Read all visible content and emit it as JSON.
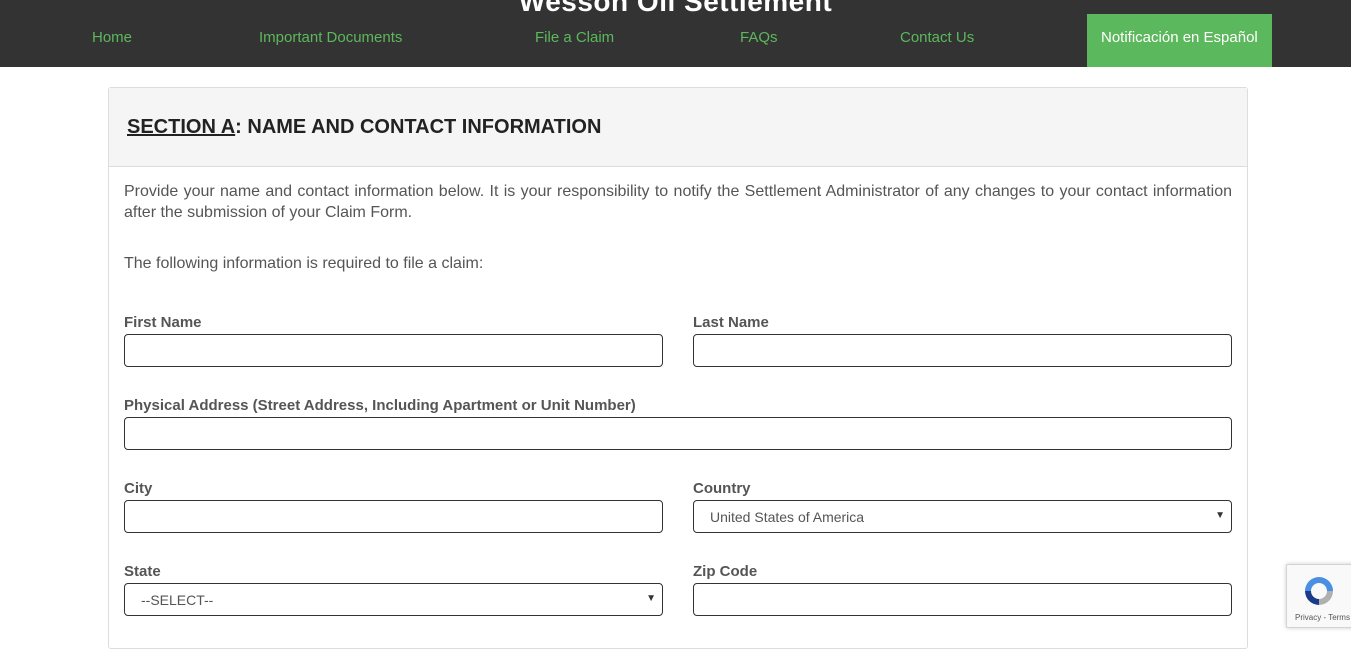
{
  "site": {
    "title": "Wesson Oil Settlement"
  },
  "nav": [
    {
      "label": "Home",
      "active": false
    },
    {
      "label": "Important Documents",
      "active": false
    },
    {
      "label": "File a Claim",
      "active": false
    },
    {
      "label": "FAQs",
      "active": false
    },
    {
      "label": "Contact Us",
      "active": false
    },
    {
      "label": "Notificación en Español",
      "active": true
    }
  ],
  "section": {
    "title_prefix": "SECTION A",
    "title_rest": ": NAME AND CONTACT INFORMATION",
    "intro": "Provide your name and contact information below. It is your responsibility to notify the Settlement Administrator of any changes to your contact information after the submission of your Claim Form.",
    "required_note": "The following information is required to file a claim:"
  },
  "fields": {
    "first_name": {
      "label": "First Name",
      "value": ""
    },
    "last_name": {
      "label": "Last Name",
      "value": ""
    },
    "address": {
      "label": "Physical Address (Street Address, Including Apartment or Unit Number)",
      "value": ""
    },
    "city": {
      "label": "City",
      "value": ""
    },
    "country": {
      "label": "Country",
      "value": "United States of America"
    },
    "state": {
      "label": "State",
      "value": "--SELECT--"
    },
    "zip": {
      "label": "Zip Code",
      "value": ""
    }
  },
  "recaptcha": {
    "links": "Privacy - Terms",
    "icon": "recaptcha-icon"
  },
  "colors": {
    "nav_bg": "#333333",
    "accent": "#5cb85c",
    "panel_heading_bg": "#f5f5f5"
  }
}
